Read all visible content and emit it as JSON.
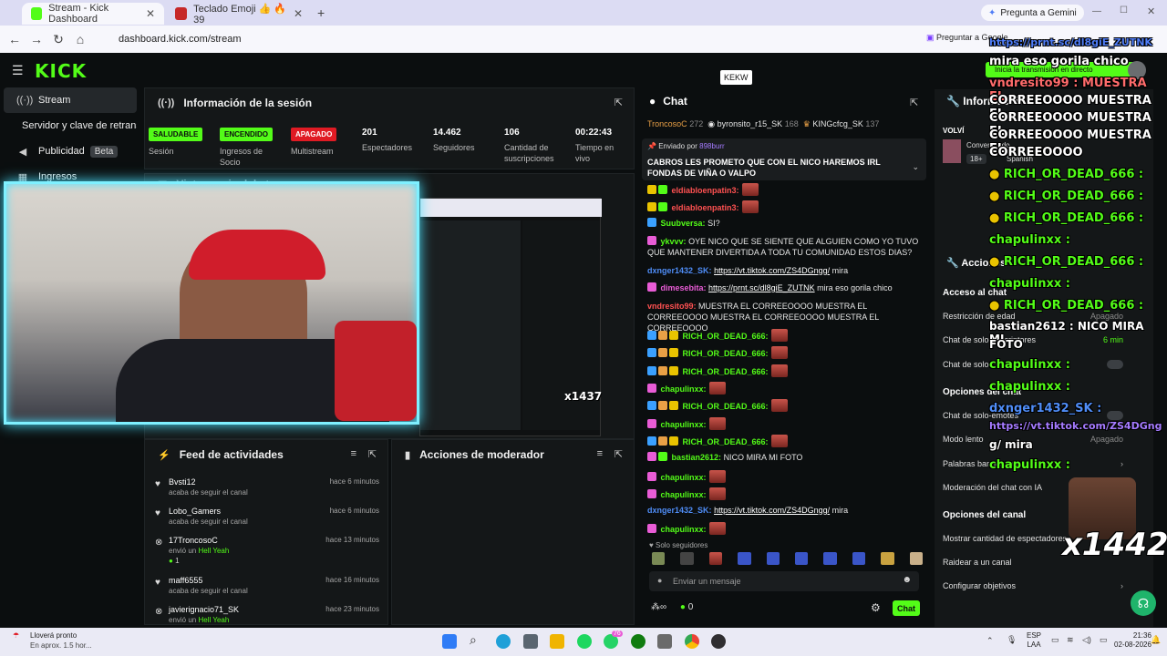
{
  "browser": {
    "tabs": [
      {
        "title": "Stream - Kick Dashboard",
        "active": true
      },
      {
        "title": "Teclado Emoji 👍 🔥 39",
        "active": false
      }
    ],
    "gemini": "Pregunta a Gemini",
    "url": "dashboard.kick.com/stream",
    "ask_google": "Preguntar a Google"
  },
  "header": {
    "logo": "KICK",
    "tooltip": "KEKW",
    "live_badge": "Inicia la transmisión en directo"
  },
  "sidebar": {
    "items": [
      {
        "label": "Stream",
        "icon": "stream-icon"
      },
      {
        "label": "Servidor y clave de retransmisión",
        "icon": ""
      },
      {
        "label": "Publicidad",
        "icon": "megaphone-icon",
        "badge": "Beta"
      },
      {
        "label": "Ingresos",
        "icon": "money-icon"
      }
    ]
  },
  "session": {
    "title": "Información de la sesión",
    "stats": [
      {
        "value": "SALUDABLE",
        "label": "Sesión",
        "kind": "green"
      },
      {
        "value": "ENCENDIDO",
        "label": "Ingresos de Socio",
        "kind": "green"
      },
      {
        "value": "APAGADO",
        "label": "Multistream",
        "kind": "red"
      },
      {
        "value": "201",
        "label": "Espectadores"
      },
      {
        "value": "14.462",
        "label": "Seguidores"
      },
      {
        "value": "106",
        "label": "Cantidad de suscripciones"
      },
      {
        "value": "00:22:43",
        "label": "Tiempo en vivo"
      }
    ],
    "preview_title": "Vista previa del stream",
    "preview_overlay": "x1437"
  },
  "feed": {
    "title": "Feed de actividades",
    "items": [
      {
        "name": "Bvsti12",
        "sub": "acaba de seguir el canal",
        "time": "hace 6 minutos",
        "icon": "heart-icon"
      },
      {
        "name": "Lobo_Gamers",
        "sub": "acaba de seguir el canal",
        "time": "hace 6 minutos",
        "icon": "heart-icon"
      },
      {
        "name": "17TroncosoC",
        "sub": "envió un",
        "sub2": "Hell Yeah",
        "extra": "1",
        "time": "hace 13 minutos",
        "icon": "kick-icon"
      },
      {
        "name": "maff6555",
        "sub": "acaba de seguir el canal",
        "time": "hace 16 minutos",
        "icon": "heart-icon"
      },
      {
        "name": "javierignacio71_SK",
        "sub": "envió un",
        "sub2": "Hell Yeah",
        "time": "hace 23 minutos",
        "icon": "kick-icon"
      }
    ]
  },
  "moderator": {
    "title": "Acciones de moderador"
  },
  "chat": {
    "title": "Chat",
    "top_users": [
      {
        "name": "TroncosoC",
        "count": "272"
      },
      {
        "name": "byronsito_r15_SK",
        "count": "168"
      },
      {
        "name": "KINGcfcg_SK",
        "count": "137"
      }
    ],
    "pinned_by_label": "Enviado por",
    "pinned_by": "898burr",
    "pinned": "CABROS LES PROMETO QUE CON EL NICO HAREMOS IRL FONDAS DE VIÑA O VALPO",
    "messages": [
      {
        "user": "eldiabloenpatin3:",
        "text": "",
        "color": "#ff5151",
        "emote": true
      },
      {
        "user": "eldiabloenpatin3:",
        "text": "",
        "color": "#ff5151",
        "emote": true
      },
      {
        "user": "Suubversa:",
        "text": "SI?",
        "color": "#53fc18"
      },
      {
        "user": "ykvvv:",
        "text": "OYE NICO QUE SE SIENTE QUE ALGUIEN COMO YO TUVO QUE MANTENER DIVERTIDA A TODA TU COMUNIDAD ESTOS DIAS?",
        "color": "#53fc18"
      },
      {
        "user": "dxnger1432_SK:",
        "link": "https://vt.tiktok.com/ZS4DGngg/",
        "text": "mira",
        "color": "#4f8df7"
      },
      {
        "user": "dimesebita:",
        "link": "https://prnt.sc/dl8giE_ZUTNK",
        "text": "mira eso gorila chico",
        "color": "#e95cd6"
      },
      {
        "user": "vndresito99:",
        "text": "MUESTRA EL CORREEOOOO MUESTRA EL CORREEOOOO MUESTRA EL CORREEOOOO MUESTRA EL CORREEOOOO",
        "color": "#ff5151"
      },
      {
        "user": "RICH_OR_DEAD_666:",
        "text": "",
        "color": "#53fc18",
        "emote": true
      },
      {
        "user": "RICH_OR_DEAD_666:",
        "text": "",
        "color": "#53fc18",
        "emote": true
      },
      {
        "user": "RICH_OR_DEAD_666:",
        "text": "",
        "color": "#53fc18",
        "emote": true
      },
      {
        "user": "chapulinxx:",
        "text": "",
        "color": "#53fc18",
        "emote": true
      },
      {
        "user": "RICH_OR_DEAD_666:",
        "text": "",
        "color": "#53fc18",
        "emote": true
      },
      {
        "user": "chapulinxx:",
        "text": "",
        "color": "#53fc18",
        "emote": true
      },
      {
        "user": "RICH_OR_DEAD_666:",
        "text": "",
        "color": "#53fc18",
        "emote": true
      },
      {
        "user": "bastian2612:",
        "text": "NICO MIRA MI FOTO",
        "color": "#53fc18"
      },
      {
        "user": "chapulinxx:",
        "text": "",
        "color": "#53fc18",
        "emote": true
      },
      {
        "user": "chapulinxx:",
        "text": "",
        "color": "#53fc18",
        "emote": true
      },
      {
        "user": "dxnger1432_SK:",
        "link": "https://vt.tiktok.com/ZS4DGngg/",
        "text": "mira",
        "color": "#4f8df7"
      },
      {
        "user": "chapulinxx:",
        "text": "",
        "color": "#53fc18",
        "emote": true
      }
    ],
    "followers_only": "Solo seguidores",
    "input_placeholder": "Enviar un mensaje",
    "points": "0",
    "send_label": "Chat"
  },
  "right_panel": {
    "info_title": "Información",
    "stream_title": "VOLVÍ",
    "category": "Conversando",
    "language": "Spanish",
    "age": "18+",
    "actions_title": "Acciones",
    "access_title": "Acceso al chat",
    "items_access": [
      {
        "label": "Restricción de edad",
        "state": "Apagado"
      },
      {
        "label": "Chat de solo-suscriptores",
        "state": "6 min"
      },
      {
        "label": "Chat de solo-"
      }
    ],
    "options_title": "Opciones del chat",
    "items_options": [
      {
        "label": "Chat de solo-emotes"
      },
      {
        "label": "Modo lento",
        "state": "Apagado"
      },
      {
        "label": "Palabras banneadas"
      },
      {
        "label": "Moderación del chat con IA"
      }
    ],
    "channel_title": "Opciones del canal",
    "items_channel": [
      {
        "label": "Mostrar cantidad de espectadores"
      },
      {
        "label": "Raidear a un canal"
      },
      {
        "label": "Configurar objetivos"
      }
    ]
  },
  "overlay": {
    "lines": [
      "https://prnt.sc/dl8giE_ZUTNK",
      "mira eso gorila chico",
      "vndresito99 : MUESTRA EL",
      "CORREEOOOO MUESTRA EL",
      "CORREEOOOO MUESTRA EL",
      "CORREEOOOO MUESTRA EL",
      "CORREEOOOO",
      "RICH_OR_DEAD_666 :",
      "RICH_OR_DEAD_666 :",
      "RICH_OR_DEAD_666 :",
      "chapulinxx :",
      "RICH_OR_DEAD_666 :",
      "chapulinxx :",
      "RICH_OR_DEAD_666 :",
      "bastian2612 : NICO MIRA MI",
      "FOTO",
      "chapulinxx :",
      "chapulinxx :",
      "dxnger1432_SK :",
      "https://vt.tiktok.com/ZS4DGng",
      "g/ mira",
      "chapulinxx :"
    ],
    "counter": "x1442"
  },
  "taskbar": {
    "weather_title": "Lloverá pronto",
    "weather_sub": "En aprox. 1.5 hor...",
    "lang1": "ESP",
    "lang2": "LAA",
    "time": "21:36",
    "date": "02-08-2026",
    "badge": "76"
  }
}
